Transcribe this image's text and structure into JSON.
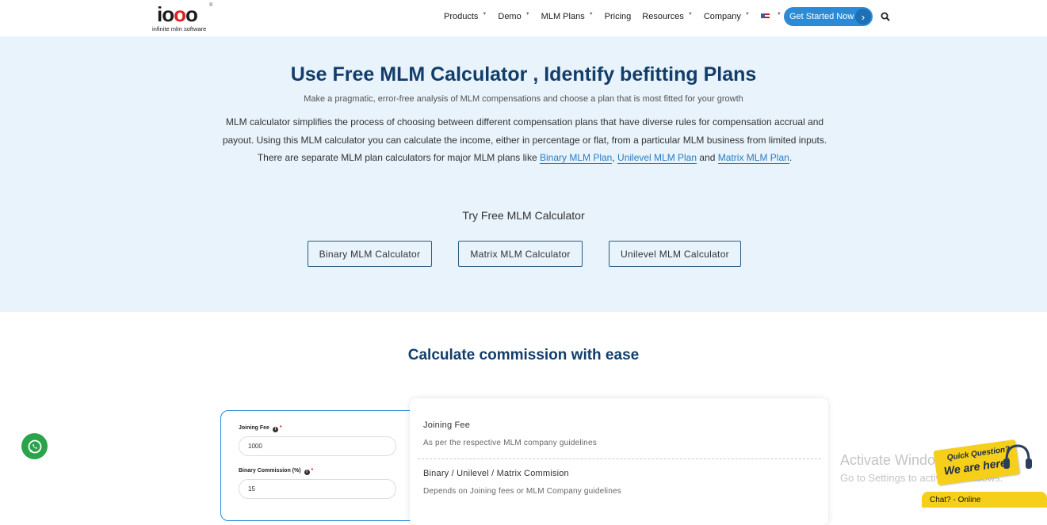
{
  "header": {
    "logo_text": "iooo",
    "logo_tagline": "infinite mlm software",
    "nav": [
      {
        "label": "Products",
        "has_dropdown": true
      },
      {
        "label": "Demo",
        "has_dropdown": true
      },
      {
        "label": "MLM Plans",
        "has_dropdown": true
      },
      {
        "label": "Pricing",
        "has_dropdown": false
      },
      {
        "label": "Resources",
        "has_dropdown": true
      },
      {
        "label": "Company",
        "has_dropdown": true
      }
    ],
    "language_icon": "us-flag-icon",
    "cta_label": "Get Started Now",
    "cta_arrow": "›",
    "search_icon": "search-icon"
  },
  "hero": {
    "title": "Use Free MLM Calculator , Identify befitting Plans",
    "subtitle": "Make a pragmatic, error-free analysis of MLM compensations and choose a plan that is most fitted for your growth",
    "desc_text": "MLM calculator simplifies the process of choosing between different compensation plans that have diverse rules for compensation accrual and payout. Using this MLM calculator you can calculate the income, either in percentage or flat, from a particular MLM business from limited inputs. There are separate MLM plan calculators for major MLM plans like",
    "link_binary": "Binary MLM Plan",
    "link_unilevel": "Unilevel MLM Plan",
    "link_and": "and",
    "link_matrix": "Matrix MLM Plan",
    "desc_end": ".",
    "try_label": "Try Free MLM Calculator",
    "buttons": [
      "Binary MLM Calculator",
      "Matrix MLM Calculator",
      "Unilevel MLM Calculator"
    ]
  },
  "commission": {
    "title": "Calculate commission with ease",
    "form": {
      "joining_fee_label": "Joining Fee",
      "joining_fee_value": "1000",
      "binary_commission_label": "Binary Commission (%)",
      "binary_commission_value": "15",
      "required_mark": "*",
      "info_icon": "info-icon"
    },
    "info": [
      {
        "heading": "Joining Fee",
        "text": "As per the respective MLM company guidelines"
      },
      {
        "heading": "Binary / Unilevel / Matrix Commision",
        "text": "Depends on Joining fees or MLM Company guidelines"
      }
    ]
  },
  "overlays": {
    "whatsapp_icon": "whatsapp-icon",
    "activate_line1": "Activate Windows",
    "activate_line2": "Go to Settings to activate Windows.",
    "quick_question": "Quick Question?",
    "we_are_here": "We are here!",
    "chat_label": "Chat? - Online"
  },
  "colors": {
    "brand_blue": "#2b8bd7",
    "title_navy": "#123d6a",
    "hero_bg": "#e8f3fb",
    "chat_yellow": "#f6cf1a",
    "whatsapp_green": "#2aa44a"
  }
}
